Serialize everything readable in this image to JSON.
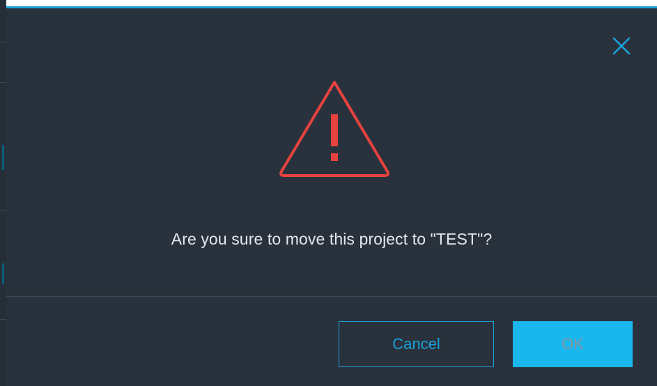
{
  "dialog": {
    "message": "Are you sure to move this project to \"TEST\"?",
    "cancel_label": "Cancel",
    "ok_label": "OK",
    "close_icon": "close-icon",
    "warning_icon": "warning-triangle-icon"
  },
  "colors": {
    "dialog_background": "#29323c",
    "accent": "#1aa1da",
    "warning": "#e8423f",
    "ok_button": "#1ab6ee"
  }
}
